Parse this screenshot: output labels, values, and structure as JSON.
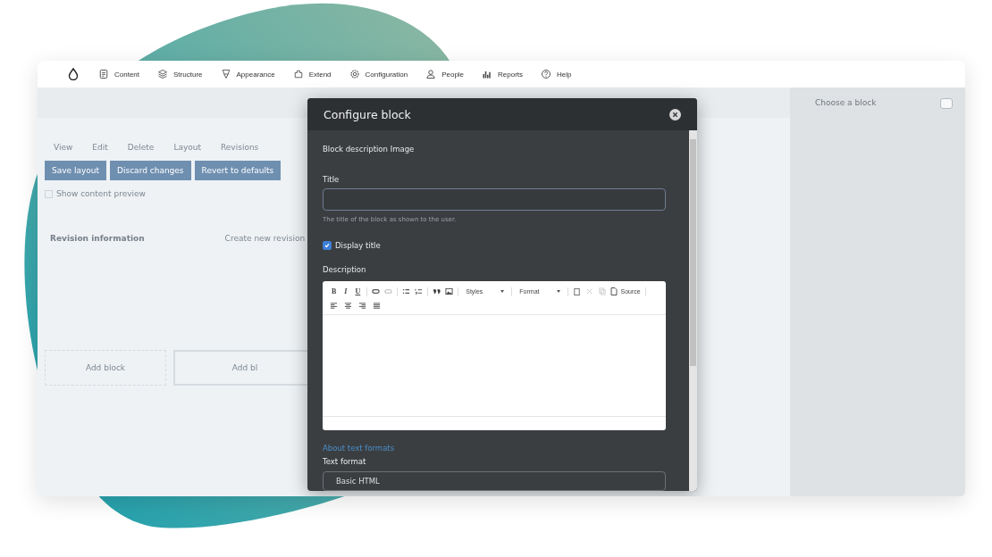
{
  "top_nav": {
    "items": [
      {
        "label": "Content"
      },
      {
        "label": "Structure"
      },
      {
        "label": "Appearance"
      },
      {
        "label": "Extend"
      },
      {
        "label": "Configuration"
      },
      {
        "label": "People"
      },
      {
        "label": "Reports"
      },
      {
        "label": "Help"
      }
    ]
  },
  "page": {
    "tabs": [
      "View",
      "Edit",
      "Delete",
      "Layout",
      "Revisions"
    ],
    "buttons": [
      "Save layout",
      "Discard changes",
      "Revert to defaults"
    ],
    "preview": {
      "label": "Show content preview",
      "checked": false
    },
    "revision": {
      "heading": "Revision information",
      "checkbox_label": "Create new revision"
    },
    "add_block_buttons": [
      "Add block",
      "Add bl"
    ]
  },
  "sidebar": {
    "title": "Choose a block"
  },
  "modal": {
    "title": "Configure block",
    "description_line": "Block description Image",
    "title_label": "Title",
    "title_hint": "The title of the block as shown to the user.",
    "display_title": {
      "label": "Display title",
      "checked": true
    },
    "description_label": "Description",
    "editor": {
      "format_buttons": [
        "B",
        "I",
        "U"
      ],
      "styles_label": "Styles",
      "format_label": "Format",
      "source_label": "Source"
    },
    "about_link": "About text formats",
    "text_format_label": "Text format",
    "text_format_value": "Basic HTML"
  }
}
